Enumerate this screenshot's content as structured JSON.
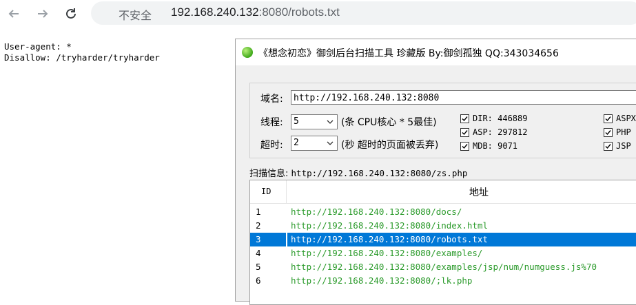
{
  "browser": {
    "security_label": "不安全",
    "url_host": "192.168.240.132",
    "url_path": ":8080/robots.txt"
  },
  "robots": {
    "line1": "User-agent: *",
    "line2": "Disallow: /tryharder/tryharder"
  },
  "app": {
    "title": "《想念初恋》御剑后台扫描工具 珍藏版 By:御剑孤独 QQ:343034656",
    "domain_label": "域名:",
    "domain_value": "http://192.168.240.132:8080",
    "threads_label": "线程:",
    "threads_value": "5",
    "threads_hint": "(条 CPU核心 * 5最佳)",
    "timeout_label": "超时:",
    "timeout_value": "2",
    "timeout_hint": "(秒 超时的页面被丢弃)",
    "dicts": [
      {
        "label": "DIR: 446889",
        "checked": true
      },
      {
        "label": "ASP: 297812",
        "checked": true
      },
      {
        "label": "MDB: 9071",
        "checked": true
      },
      {
        "label": "ASPX",
        "checked": true
      },
      {
        "label": "PHP",
        "checked": true
      },
      {
        "label": "JSP",
        "checked": true
      }
    ],
    "scan_info_label": "扫描信息:",
    "scan_info_value": "http://192.168.240.132:8080/zs.php",
    "list": {
      "col_id": "ID",
      "col_addr": "地址",
      "rows": [
        {
          "id": "1",
          "url": "http://192.168.240.132:8080/docs/"
        },
        {
          "id": "2",
          "url": "http://192.168.240.132:8080/index.html"
        },
        {
          "id": "3",
          "url": "http://192.168.240.132:8080/robots.txt"
        },
        {
          "id": "4",
          "url": "http://192.168.240.132:8080/examples/"
        },
        {
          "id": "5",
          "url": "http://192.168.240.132:8080/examples/jsp/num/numguess.js%70"
        },
        {
          "id": "6",
          "url": "http://192.168.240.132:8080/;lk.php"
        }
      ],
      "selected_id": "3"
    }
  },
  "colors": {
    "url_green": "#2a9a2a",
    "selection_blue": "#0078d7"
  },
  "icons": [
    "back-arrow-icon",
    "forward-arrow-icon",
    "reload-icon",
    "app-orb-icon",
    "checkmark-icon",
    "dropdown-arrow-icon"
  ]
}
